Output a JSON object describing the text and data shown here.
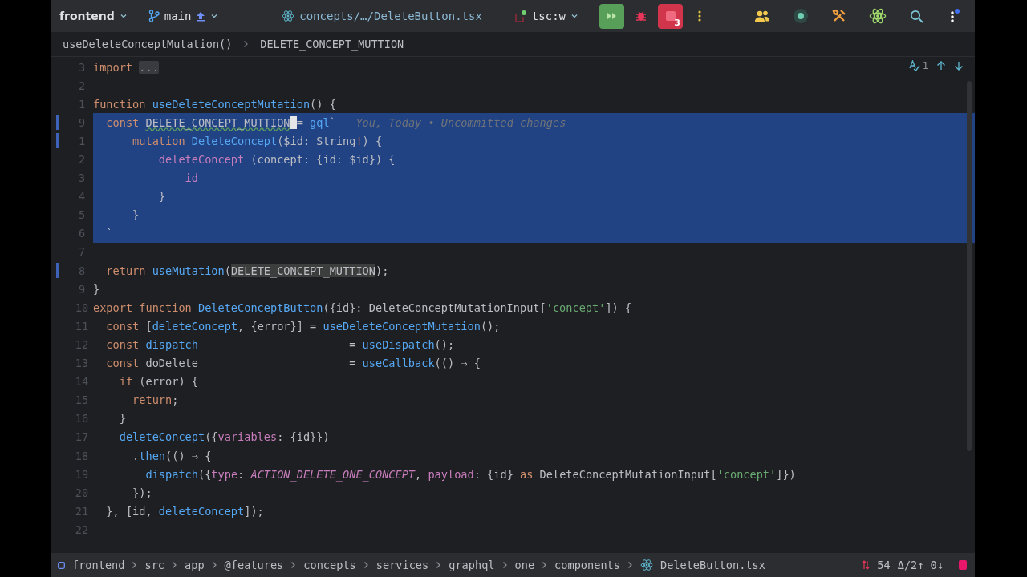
{
  "toolbar": {
    "project": "frontend",
    "branch": "main",
    "file_tab": "concepts/…/DeleteButton.tsx",
    "run_config": "tsc:w",
    "stop_badge": "3"
  },
  "breadcrumb": [
    "useDeleteConceptMutation()",
    "DELETE_CONCEPT_MUTTION"
  ],
  "inspection": {
    "count": "1"
  },
  "editor": {
    "lines": [
      {
        "number": "3",
        "selected": false,
        "modified": false,
        "tokens": [
          {
            "kind": "kw",
            "text": "import "
          },
          {
            "kind": "fold",
            "text": "..."
          }
        ]
      },
      {
        "number": "2",
        "selected": false,
        "modified": false
      },
      {
        "number": "1",
        "selected": false,
        "modified": false,
        "tokens": [
          {
            "kind": "kw",
            "text": "function "
          },
          {
            "kind": "fn",
            "text": "useDeleteConceptMutation"
          },
          {
            "kind": "plain",
            "text": "() {"
          }
        ]
      },
      {
        "number": "9",
        "selected": true,
        "modified": true,
        "tokens": [
          {
            "kind": "kw",
            "text": "  const "
          },
          {
            "kind": "warn",
            "text": "DELETE_CONCEPT_MUTTION",
            "caret": true
          },
          {
            "kind": "plain",
            "text": " = "
          },
          {
            "kind": "fn",
            "text": "gql"
          },
          {
            "kind": "plain",
            "text": "`   "
          },
          {
            "kind": "hint",
            "text": "You, Today • Uncommitted changes"
          }
        ]
      },
      {
        "number": "1",
        "selected": true,
        "modified": true,
        "tokens": [
          {
            "kind": "kw",
            "text": "      mutation "
          },
          {
            "kind": "fn",
            "text": "DeleteConcept"
          },
          {
            "kind": "plain",
            "text": "($id: String"
          },
          {
            "kind": "bang",
            "text": "!"
          },
          {
            "kind": "plain",
            "text": ") {"
          }
        ]
      },
      {
        "number": "2",
        "selected": true,
        "modified": false,
        "tokens": [
          {
            "kind": "prop",
            "text": "          deleteConcept"
          },
          {
            "kind": "plain",
            "text": " (concept: {id: $id}) {"
          }
        ]
      },
      {
        "number": "3",
        "selected": true,
        "modified": false,
        "tokens": [
          {
            "kind": "prop",
            "text": "              id"
          }
        ]
      },
      {
        "number": "4",
        "selected": true,
        "modified": false,
        "tokens": [
          {
            "kind": "plain",
            "text": "          }"
          }
        ]
      },
      {
        "number": "5",
        "selected": true,
        "modified": false,
        "tokens": [
          {
            "kind": "plain",
            "text": "      }"
          }
        ]
      },
      {
        "number": "6",
        "selected": true,
        "modified": false,
        "tokens": [
          {
            "kind": "plain",
            "text": "  `"
          }
        ]
      },
      {
        "number": "7",
        "selected": false,
        "modified": false
      },
      {
        "number": "8",
        "selected": false,
        "modified": true,
        "tokens": [
          {
            "kind": "kw",
            "text": "  return "
          },
          {
            "kind": "fn",
            "text": "useMutation"
          },
          {
            "kind": "plain",
            "text": "("
          },
          {
            "kind": "usage",
            "text": "DELETE_CONCEPT_MUTTION"
          },
          {
            "kind": "plain",
            "text": ");"
          }
        ]
      },
      {
        "number": "9",
        "selected": false,
        "modified": false,
        "tokens": [
          {
            "kind": "plain",
            "text": "}"
          }
        ]
      },
      {
        "number": "10",
        "selected": false,
        "modified": false,
        "tokens": [
          {
            "kind": "kw",
            "text": "export function "
          },
          {
            "kind": "fn",
            "text": "DeleteConceptButton"
          },
          {
            "kind": "plain",
            "text": "({id}: DeleteConceptMutationInput["
          },
          {
            "kind": "str",
            "text": "'concept'"
          },
          {
            "kind": "plain",
            "text": "]) {"
          }
        ]
      },
      {
        "number": "11",
        "selected": false,
        "modified": false,
        "tokens": [
          {
            "kind": "kw",
            "text": "  const "
          },
          {
            "kind": "plain",
            "text": "["
          },
          {
            "kind": "fn",
            "text": "deleteConcept"
          },
          {
            "kind": "plain",
            "text": ", {error}] = "
          },
          {
            "kind": "fn",
            "text": "useDeleteConceptMutation"
          },
          {
            "kind": "plain",
            "text": "();"
          }
        ]
      },
      {
        "number": "12",
        "selected": false,
        "modified": false,
        "tokens": [
          {
            "kind": "kw",
            "text": "  const "
          },
          {
            "kind": "fn",
            "text": "dispatch"
          },
          {
            "kind": "plain",
            "text": "                       = "
          },
          {
            "kind": "fn",
            "text": "useDispatch"
          },
          {
            "kind": "plain",
            "text": "();"
          }
        ]
      },
      {
        "number": "13",
        "selected": false,
        "modified": false,
        "tokens": [
          {
            "kind": "kw",
            "text": "  const "
          },
          {
            "kind": "plain",
            "text": "doDelete                       = "
          },
          {
            "kind": "fn",
            "text": "useCallback"
          },
          {
            "kind": "plain",
            "text": "(() ⇒ {"
          }
        ]
      },
      {
        "number": "14",
        "selected": false,
        "modified": false,
        "tokens": [
          {
            "kind": "kw",
            "text": "    if "
          },
          {
            "kind": "plain",
            "text": "(error) {"
          }
        ]
      },
      {
        "number": "15",
        "selected": false,
        "modified": false,
        "tokens": [
          {
            "kind": "kw",
            "text": "      return"
          },
          {
            "kind": "plain",
            "text": ";"
          }
        ]
      },
      {
        "number": "16",
        "selected": false,
        "modified": false,
        "tokens": [
          {
            "kind": "plain",
            "text": "    }"
          }
        ]
      },
      {
        "number": "17",
        "selected": false,
        "modified": false,
        "tokens": [
          {
            "kind": "fn",
            "text": "    deleteConcept"
          },
          {
            "kind": "plain",
            "text": "({"
          },
          {
            "kind": "prop",
            "text": "variables"
          },
          {
            "kind": "plain",
            "text": ": {id}})"
          }
        ]
      },
      {
        "number": "18",
        "selected": false,
        "modified": false,
        "tokens": [
          {
            "kind": "plain",
            "text": "      ."
          },
          {
            "kind": "fn",
            "text": "then"
          },
          {
            "kind": "plain",
            "text": "(() ⇒ {"
          }
        ]
      },
      {
        "number": "19",
        "selected": false,
        "modified": false,
        "tokens": [
          {
            "kind": "fn",
            "text": "        dispatch"
          },
          {
            "kind": "plain",
            "text": "({"
          },
          {
            "kind": "prop",
            "text": "type"
          },
          {
            "kind": "plain",
            "text": ": "
          },
          {
            "kind": "const",
            "text": "ACTION_DELETE_ONE_CONCEPT"
          },
          {
            "kind": "plain",
            "text": ", "
          },
          {
            "kind": "prop",
            "text": "payload"
          },
          {
            "kind": "plain",
            "text": ": {id} "
          },
          {
            "kind": "kw",
            "text": "as "
          },
          {
            "kind": "plain",
            "text": "DeleteConceptMutationInput["
          },
          {
            "kind": "str",
            "text": "'concept'"
          },
          {
            "kind": "plain",
            "text": "]})"
          }
        ]
      },
      {
        "number": "20",
        "selected": false,
        "modified": false,
        "tokens": [
          {
            "kind": "plain",
            "text": "      });"
          }
        ]
      },
      {
        "number": "21",
        "selected": false,
        "modified": false,
        "tokens": [
          {
            "kind": "plain",
            "text": "  }, [id, "
          },
          {
            "kind": "fn",
            "text": "deleteConcept"
          },
          {
            "kind": "plain",
            "text": "]);"
          }
        ]
      },
      {
        "number": "22",
        "selected": false,
        "modified": false
      }
    ]
  },
  "status_bar": {
    "path": [
      "frontend",
      "src",
      "app",
      "@features",
      "concepts",
      "services",
      "graphql",
      "one",
      "components",
      "DeleteButton.tsx"
    ],
    "changes": "54",
    "vcs_status": "Δ/2↑ 0↓"
  }
}
